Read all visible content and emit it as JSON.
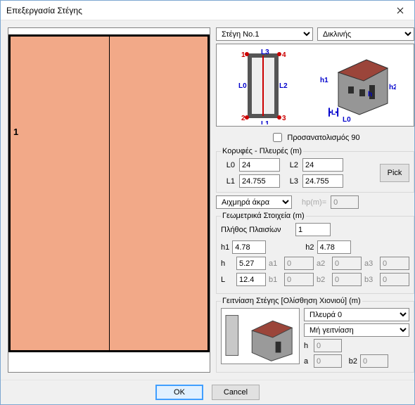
{
  "title": "Επεξεργασία Στέγης",
  "roofSelect": "Στέγη Νο.1",
  "roofTypeSelect": "Δικλινής",
  "orientation": {
    "label": "Προσανατολισμός 90",
    "checked": false
  },
  "verticesSides": {
    "legend": "Κορυφές - Πλευρές (m)",
    "L0": "24",
    "L2": "24",
    "L1": "24.755",
    "L3": "24.755",
    "pick": "Pick",
    "lblL0": "L0",
    "lblL1": "L1",
    "lblL2": "L2",
    "lblL3": "L3"
  },
  "edgeType": {
    "label": "Αιχμηρά άκρα",
    "hpLabel": "hp(m)=",
    "hpVal": "0"
  },
  "geometry": {
    "legend": "Γεωμετρικά Στοιχεία (m)",
    "framesLabel": "Πλήθος Πλαισίων",
    "framesVal": "1",
    "h1Lbl": "h1",
    "h1": "4.78",
    "h2Lbl": "h2",
    "h2": "4.78",
    "hLbl": "h",
    "h": "5.27",
    "a1Lbl": "a1",
    "a1": "0",
    "a2Lbl": "a2",
    "a2": "0",
    "a3Lbl": "a3",
    "a3": "0",
    "LLbl": "L",
    "L": "12.4",
    "b1Lbl": "b1",
    "b1": "0",
    "b2Lbl": "b2",
    "b2": "0",
    "b3Lbl": "b3",
    "b3": "0"
  },
  "neighbor": {
    "legend": "Γειτνίαση Στέγης [Ολίσθηση Χιονιού] (m)",
    "side": "Πλευρά 0",
    "type": "Μή γειτνίαση",
    "hLbl": "h",
    "h": "0",
    "aLbl": "a",
    "a": "0",
    "b2Lbl": "b2",
    "b2": "0"
  },
  "footer": {
    "ok": "OK",
    "cancel": "Cancel"
  },
  "previewLabel": "1"
}
